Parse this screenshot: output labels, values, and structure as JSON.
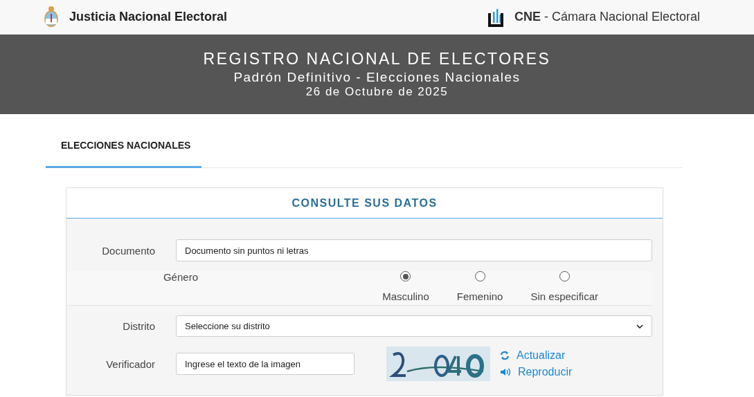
{
  "header": {
    "left_title": "Justicia Nacional Electoral",
    "right_title": "**CNE** - Cámara Nacional Electoral"
  },
  "banner": {
    "title": "REGISTRO NACIONAL DE ELECTORES",
    "subtitle": "Padrón Definitivo - Elecciones Nacionales",
    "date": "26 de Octubre de 2025"
  },
  "tabs": [
    {
      "label": "ELECCIONES NACIONALES",
      "selected": true
    }
  ],
  "form": {
    "title": "CONSULTE SUS DATOS",
    "documento": {
      "label": "Documento",
      "placeholder": "Documento sin puntos ni letras"
    },
    "genero": {
      "label": "Género",
      "options": [
        {
          "label": "Masculino",
          "selected": true
        },
        {
          "label": "Femenino",
          "selected": false
        },
        {
          "label": "Sin especificar",
          "selected": false
        }
      ]
    },
    "distrito": {
      "label": "Distrito",
      "value": "Seleccione su distrito"
    },
    "verificador": {
      "label": "Verificador",
      "placeholder": "Ingrese el texto de la imagen",
      "refresh": "Actualizar",
      "audio": "Reproducir"
    }
  }
}
